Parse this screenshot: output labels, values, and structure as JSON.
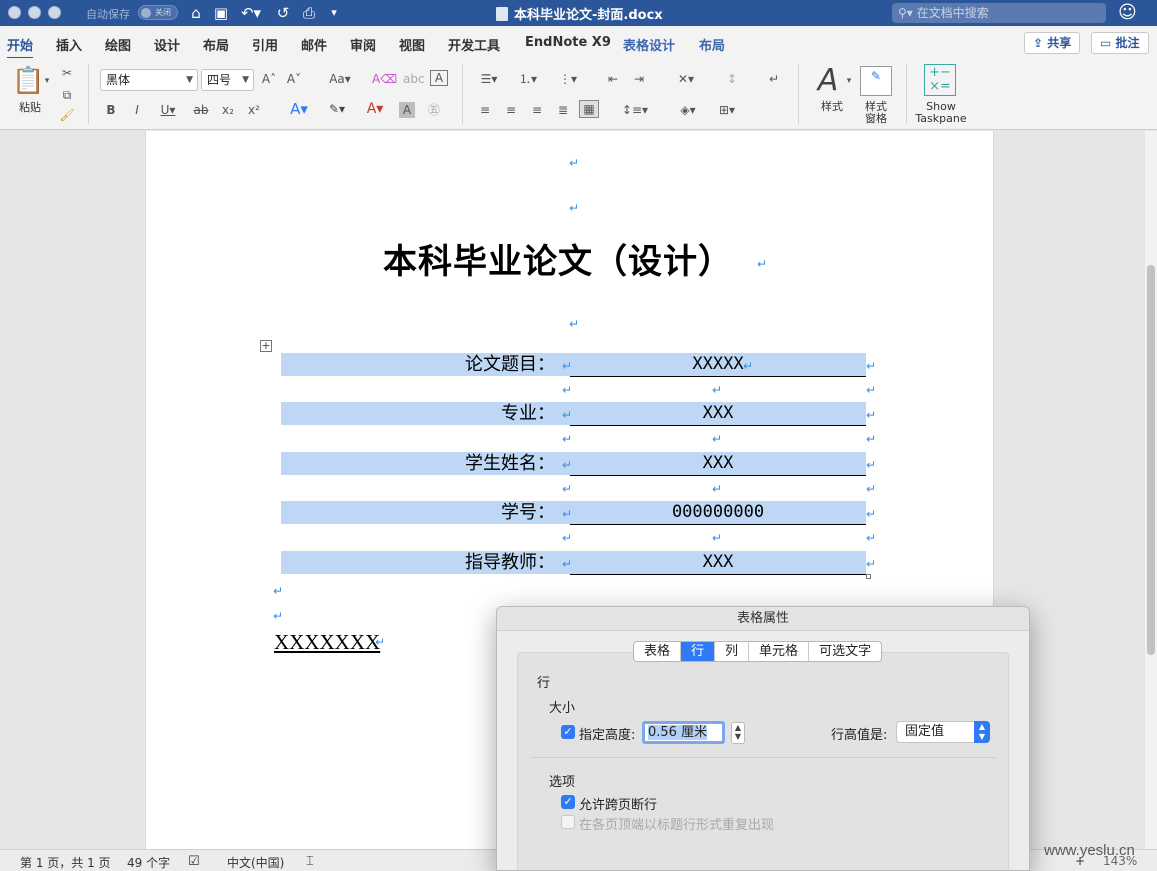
{
  "titlebar": {
    "autosave_label": "自动保存",
    "autosave_state": "关闭",
    "document_title": "本科毕业论文-封面.docx",
    "search_placeholder": "在文档中搜索"
  },
  "ribbon_tabs": [
    "开始",
    "插入",
    "绘图",
    "设计",
    "布局",
    "引用",
    "邮件",
    "审阅",
    "视图",
    "开发工具",
    "EndNote X9",
    "表格设计",
    "布局"
  ],
  "share_label": "共享",
  "comments_label": "批注",
  "ribbon": {
    "paste_label": "粘贴",
    "font_name": "黑体",
    "font_size": "四号",
    "styles_label": "样式",
    "styles_pane_label": "样式\n窗格",
    "styles_pane_line1": "样式",
    "styles_pane_line2": "窗格",
    "taskpane_line1": "Show",
    "taskpane_line2": "Taskpane"
  },
  "document": {
    "title": "本科毕业论文（设计）",
    "rows": [
      {
        "label": "论文题目：",
        "value": "XXXXX"
      },
      {
        "label": "专业：",
        "value": "XXX"
      },
      {
        "label": "学生姓名：",
        "value": "XXX"
      },
      {
        "label": "学号：",
        "value": "000000000"
      },
      {
        "label": "指导教师：",
        "value": "XXX"
      }
    ],
    "footer_text": "XXXXXXX"
  },
  "statusbar": {
    "page_info": "第 1 页，共 1 页",
    "word_count": "49 个字",
    "language": "中文(中国)",
    "zoom": "143%"
  },
  "watermark": "www.yeslu.cn",
  "dialog": {
    "title": "表格属性",
    "tabs": [
      "表格",
      "行",
      "列",
      "单元格",
      "可选文字"
    ],
    "active_tab": "行",
    "section_row": "行",
    "section_size": "大小",
    "specify_height_label": "指定高度:",
    "height_value": "0.56 厘米",
    "row_height_is_label": "行高值是:",
    "row_height_mode": "固定值",
    "section_options": "选项",
    "allow_break_label": "允许跨页断行",
    "repeat_header_label": "在各页顶端以标题行形式重复出现"
  }
}
